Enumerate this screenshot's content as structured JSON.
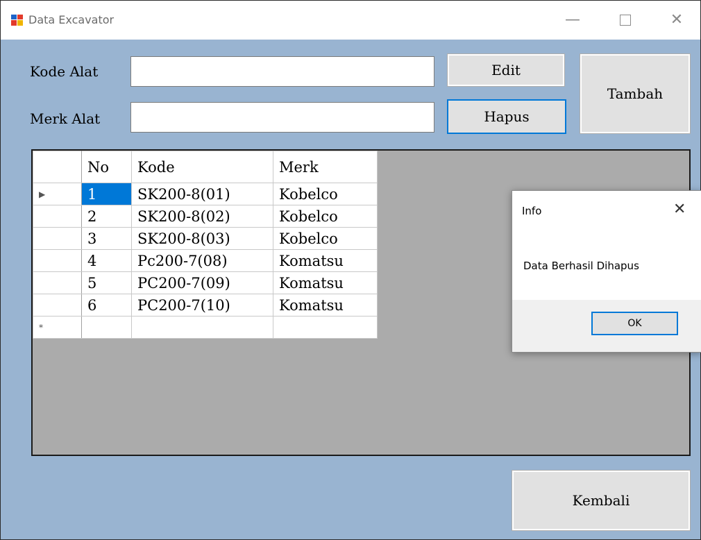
{
  "window": {
    "title": "Data Excavator",
    "minimize_glyph": "—",
    "close_glyph": "✕"
  },
  "form": {
    "kode_label": "Kode Alat",
    "kode_value": "",
    "merk_label": "Merk Alat",
    "merk_value": "",
    "edit_label": "Edit",
    "hapus_label": "Hapus",
    "tambah_label": "Tambah",
    "kembali_label": "Kembali"
  },
  "grid": {
    "columns": [
      "No",
      "Kode",
      "Merk"
    ],
    "current_row_marker": "▶",
    "new_row_marker": "*",
    "rows": [
      {
        "no": "1",
        "kode": "SK200-8(01)",
        "merk": "Kobelco"
      },
      {
        "no": "2",
        "kode": "SK200-8(02)",
        "merk": "Kobelco"
      },
      {
        "no": "3",
        "kode": "SK200-8(03)",
        "merk": "Kobelco"
      },
      {
        "no": "4",
        "kode": "Pc200-7(08)",
        "merk": "Komatsu"
      },
      {
        "no": "5",
        "kode": "PC200-7(09)",
        "merk": "Komatsu"
      },
      {
        "no": "6",
        "kode": "PC200-7(10)",
        "merk": "Komatsu"
      }
    ]
  },
  "dialog": {
    "title": "Info",
    "close_glyph": "✕",
    "message": "Data Berhasil Dihapus",
    "ok_label": "OK"
  },
  "colors": {
    "client_background": "#99b4d1",
    "grid_background": "#ababab",
    "selection": "#0078d7",
    "focus_border": "#0078d7"
  },
  "icons": {
    "app": "windows-form-icon",
    "minimize": "minimize-icon",
    "maximize": "maximize-icon",
    "close": "close-icon"
  }
}
